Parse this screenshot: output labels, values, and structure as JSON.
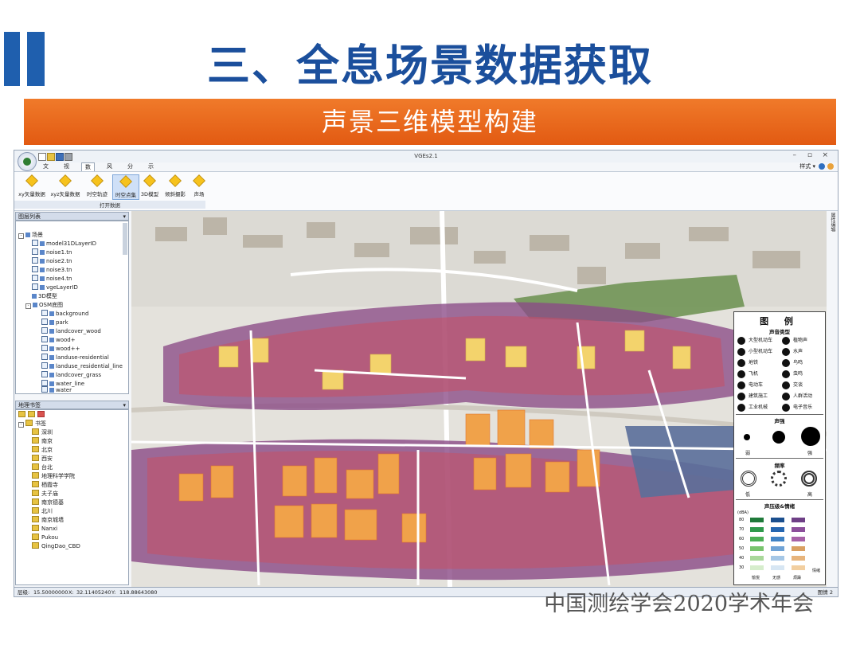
{
  "slide": {
    "title": "三、全息场景数据获取",
    "banner": "声景三维模型构建",
    "footer": "中国测绘学会2020学术年会"
  },
  "app": {
    "window_title": "VGEs2.1",
    "menu": [
      "文件",
      "视图",
      "数据",
      "风格",
      "分析",
      "示例"
    ],
    "active_menu": "数据",
    "style_label": "样式 ▾",
    "ribbon_buttons": [
      "xy矢量数据",
      "xyz矢量数据",
      "时空轨迹",
      "时空点集",
      "3D模型",
      "倾斜摄影",
      "声场"
    ],
    "selected_ribbon_button": "时空点集",
    "ribbon_group_label": "打开数据",
    "layer_panel_title": "图层列表",
    "layer_tree": {
      "root": "场景",
      "items": [
        "model31DLayerID",
        "noise1.tn",
        "noise2.tn",
        "noise3.tn",
        "noise4.tn",
        "vgeLayerID",
        "3D模型"
      ],
      "osm_label": "OSM底图",
      "osm_items": [
        "background",
        "park",
        "landcover_wood",
        "wood+",
        "wood++",
        "landuse-residential",
        "landuse_residential_line",
        "landcover_grass",
        "water_line",
        "water"
      ]
    },
    "bookmark_panel_title": "地理书签",
    "bookmarks": {
      "root": "书签",
      "items": [
        "深圳",
        "南京",
        "北京",
        "西安",
        "台北",
        "地理科学学院",
        "栖霞寺",
        "夫子庙",
        "南京德基",
        "北川",
        "南京城墙",
        "Nanxi",
        "Pukou",
        "QingDao_CBD"
      ]
    },
    "status": {
      "level_label": "层级:",
      "level_value": "15.50000000",
      "x_label": "X:",
      "x_value": "32.11405240",
      "y_label": "Y:",
      "y_value": "118.88643080",
      "right_label": "图情 2"
    },
    "side_tab": "属性编辑"
  },
  "legend": {
    "title": "图 例",
    "sound_type_title": "声音类型",
    "sound_types_left": [
      "大型机动车",
      "小型机动车",
      "地铁",
      "飞机",
      "电动车",
      "建筑施工",
      "工业机械"
    ],
    "sound_types_right": [
      "植物声",
      "水声",
      "鸟鸣",
      "虫鸣",
      "交谈",
      "人群活动",
      "电子音乐"
    ],
    "intensity_title": "声强",
    "intensity_low": "弱",
    "intensity_high": "强",
    "frequency_title": "频率",
    "frequency_low": "低",
    "frequency_high": "高",
    "spl_title": "声压级&情绪",
    "spl_unit": "(dBA)",
    "spl_ticks": [
      "80",
      "70",
      "60",
      "50",
      "40",
      "30"
    ],
    "emotion_labels": [
      "愉悦",
      "无感",
      "烦躁"
    ],
    "emotion_axis": "情绪",
    "colors": {
      "green": [
        "#1f7a3a",
        "#2f9a4c",
        "#4caf55",
        "#79c46e",
        "#a9d89a",
        "#d6edcc"
      ],
      "blue": [
        "#1b4f8e",
        "#2566b0",
        "#3f82c4",
        "#6fa3d6",
        "#a5c7e6",
        "#d7e6f3"
      ],
      "purple_orange": [
        "#6e3f86",
        "#8c4f9b",
        "#a762a7",
        "#d9a062",
        "#e7b47c",
        "#f2cfa0"
      ]
    }
  },
  "colors": {
    "title_blue": "#1b4f9c",
    "banner_orange": "#e8641a",
    "noise_purple": "#8a4a86",
    "noise_red": "#c75064",
    "building_orange": "#f0a24a",
    "building_yellow": "#f3d36c",
    "water": "#5a6f9a"
  }
}
